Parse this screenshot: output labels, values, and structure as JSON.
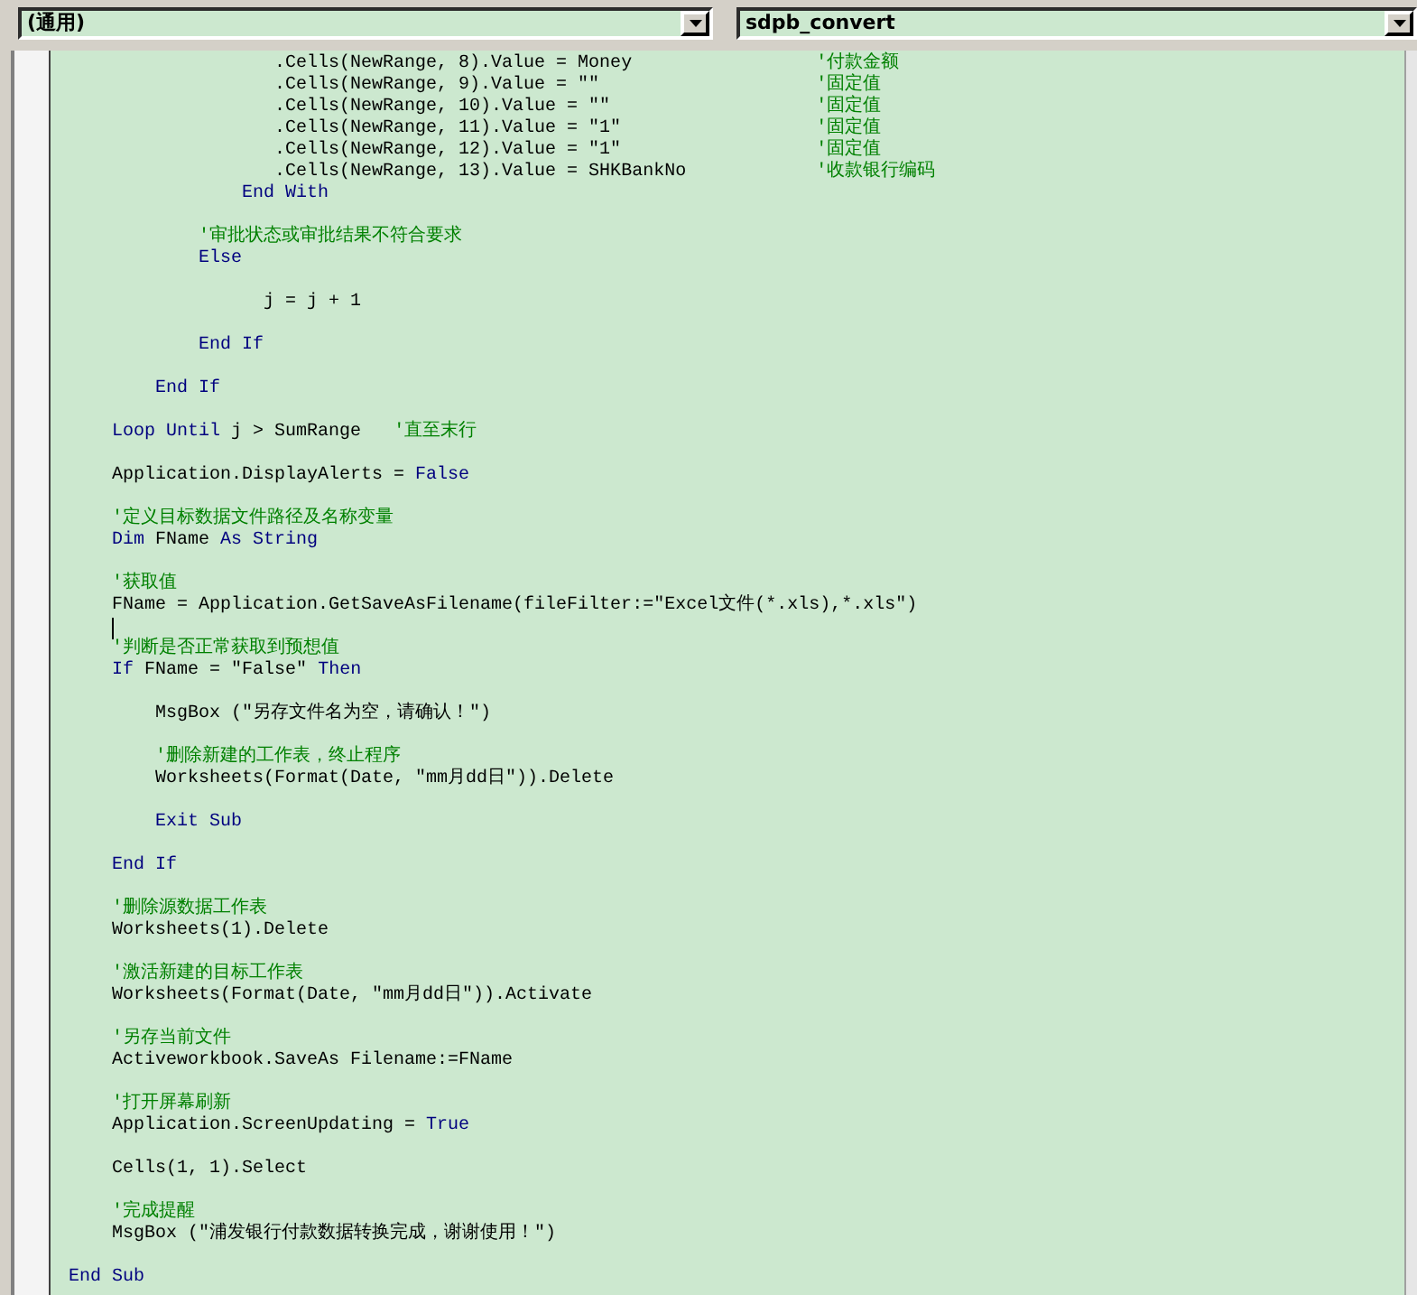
{
  "object_dropdown": {
    "value": "(通用)"
  },
  "procedure_dropdown": {
    "value": "sdpb_convert"
  },
  "code_lines": [
    {
      "cursor": false,
      "tokens": [
        {
          "kind": "code",
          "text": "                   .Cells(NewRange, 8).Value = Money"
        },
        {
          "kind": "comment",
          "text": "                 '付款金额"
        }
      ]
    },
    {
      "cursor": false,
      "tokens": [
        {
          "kind": "code",
          "text": "                   .Cells(NewRange, 9).Value = \"\""
        },
        {
          "kind": "comment",
          "text": "                    '固定值"
        }
      ]
    },
    {
      "cursor": false,
      "tokens": [
        {
          "kind": "code",
          "text": "                   .Cells(NewRange, 10).Value = \"\""
        },
        {
          "kind": "comment",
          "text": "                   '固定值"
        }
      ]
    },
    {
      "cursor": false,
      "tokens": [
        {
          "kind": "code",
          "text": "                   .Cells(NewRange, 11).Value = \"1\""
        },
        {
          "kind": "comment",
          "text": "                  '固定值"
        }
      ]
    },
    {
      "cursor": false,
      "tokens": [
        {
          "kind": "code",
          "text": "                   .Cells(NewRange, 12).Value = \"1\""
        },
        {
          "kind": "comment",
          "text": "                  '固定值"
        }
      ]
    },
    {
      "cursor": false,
      "tokens": [
        {
          "kind": "code",
          "text": "                   .Cells(NewRange, 13).Value = SHKBankNo"
        },
        {
          "kind": "comment",
          "text": "            '收款银行编码"
        }
      ]
    },
    {
      "cursor": false,
      "tokens": [
        {
          "kind": "keyword",
          "text": "                End With"
        }
      ]
    },
    {
      "cursor": false
    },
    {
      "cursor": false,
      "tokens": [
        {
          "kind": "comment",
          "text": "            '审批状态或审批结果不符合要求"
        }
      ]
    },
    {
      "cursor": false,
      "tokens": [
        {
          "kind": "keyword",
          "text": "            Else"
        }
      ]
    },
    {
      "cursor": false
    },
    {
      "cursor": false,
      "tokens": [
        {
          "kind": "code",
          "text": "                  j = j + 1"
        }
      ]
    },
    {
      "cursor": false
    },
    {
      "cursor": false,
      "tokens": [
        {
          "kind": "keyword",
          "text": "            End If"
        }
      ]
    },
    {
      "cursor": false
    },
    {
      "cursor": false,
      "tokens": [
        {
          "kind": "keyword",
          "text": "        End If"
        }
      ]
    },
    {
      "cursor": false
    },
    {
      "cursor": false,
      "tokens": [
        {
          "kind": "keyword",
          "text": "    Loop Until"
        },
        {
          "kind": "code",
          "text": " j > SumRange"
        },
        {
          "kind": "comment",
          "text": "   '直至末行"
        }
      ]
    },
    {
      "cursor": false
    },
    {
      "cursor": false,
      "tokens": [
        {
          "kind": "code",
          "text": "    Application.DisplayAlerts = "
        },
        {
          "kind": "keyword",
          "text": "False"
        }
      ]
    },
    {
      "cursor": false
    },
    {
      "cursor": false,
      "tokens": [
        {
          "kind": "comment",
          "text": "    '定义目标数据文件路径及名称变量"
        }
      ]
    },
    {
      "cursor": false,
      "tokens": [
        {
          "kind": "keyword",
          "text": "    Dim"
        },
        {
          "kind": "code",
          "text": " FName "
        },
        {
          "kind": "keyword",
          "text": "As String"
        }
      ]
    },
    {
      "cursor": false
    },
    {
      "cursor": false,
      "tokens": [
        {
          "kind": "comment",
          "text": "    '获取值"
        }
      ]
    },
    {
      "cursor": false,
      "tokens": [
        {
          "kind": "code",
          "text": "    FName = Application.GetSaveAsFilename(fileFilter:=\"Excel文件(*.xls),*.xls\")"
        }
      ]
    },
    {
      "cursor": true
    },
    {
      "cursor": false,
      "tokens": [
        {
          "kind": "comment",
          "text": "    '判断是否正常获取到预想值"
        }
      ]
    },
    {
      "cursor": false,
      "tokens": [
        {
          "kind": "keyword",
          "text": "    If"
        },
        {
          "kind": "code",
          "text": " FName = \"False\" "
        },
        {
          "kind": "keyword",
          "text": "Then"
        }
      ]
    },
    {
      "cursor": false
    },
    {
      "cursor": false,
      "tokens": [
        {
          "kind": "code",
          "text": "        MsgBox (\"另存文件名为空，请确认！\")"
        }
      ]
    },
    {
      "cursor": false
    },
    {
      "cursor": false,
      "tokens": [
        {
          "kind": "comment",
          "text": "        '删除新建的工作表，终止程序"
        }
      ]
    },
    {
      "cursor": false,
      "tokens": [
        {
          "kind": "code",
          "text": "        Worksheets(Format(Date, \"mm月dd日\")).Delete"
        }
      ]
    },
    {
      "cursor": false
    },
    {
      "cursor": false,
      "tokens": [
        {
          "kind": "keyword",
          "text": "        Exit Sub"
        }
      ]
    },
    {
      "cursor": false
    },
    {
      "cursor": false,
      "tokens": [
        {
          "kind": "keyword",
          "text": "    End If"
        }
      ]
    },
    {
      "cursor": false
    },
    {
      "cursor": false,
      "tokens": [
        {
          "kind": "comment",
          "text": "    '删除源数据工作表"
        }
      ]
    },
    {
      "cursor": false,
      "tokens": [
        {
          "kind": "code",
          "text": "    Worksheets(1).Delete"
        }
      ]
    },
    {
      "cursor": false
    },
    {
      "cursor": false,
      "tokens": [
        {
          "kind": "comment",
          "text": "    '激活新建的目标工作表"
        }
      ]
    },
    {
      "cursor": false,
      "tokens": [
        {
          "kind": "code",
          "text": "    Worksheets(Format(Date, \"mm月dd日\")).Activate"
        }
      ]
    },
    {
      "cursor": false
    },
    {
      "cursor": false,
      "tokens": [
        {
          "kind": "comment",
          "text": "    '另存当前文件"
        }
      ]
    },
    {
      "cursor": false,
      "tokens": [
        {
          "kind": "code",
          "text": "    Activeworkbook.SaveAs Filename:=FName"
        }
      ]
    },
    {
      "cursor": false
    },
    {
      "cursor": false,
      "tokens": [
        {
          "kind": "comment",
          "text": "    '打开屏幕刷新"
        }
      ]
    },
    {
      "cursor": false,
      "tokens": [
        {
          "kind": "code",
          "text": "    Application.ScreenUpdating = "
        },
        {
          "kind": "keyword",
          "text": "True"
        }
      ]
    },
    {
      "cursor": false
    },
    {
      "cursor": false,
      "tokens": [
        {
          "kind": "code",
          "text": "    Cells(1, 1).Select"
        }
      ]
    },
    {
      "cursor": false
    },
    {
      "cursor": false,
      "tokens": [
        {
          "kind": "comment",
          "text": "    '完成提醒"
        }
      ]
    },
    {
      "cursor": false,
      "tokens": [
        {
          "kind": "code",
          "text": "    MsgBox (\"浦发银行付款数据转换完成，谢谢使用！\")"
        }
      ]
    },
    {
      "cursor": false
    },
    {
      "cursor": false,
      "tokens": [
        {
          "kind": "keyword",
          "text": "End Sub"
        }
      ]
    }
  ]
}
